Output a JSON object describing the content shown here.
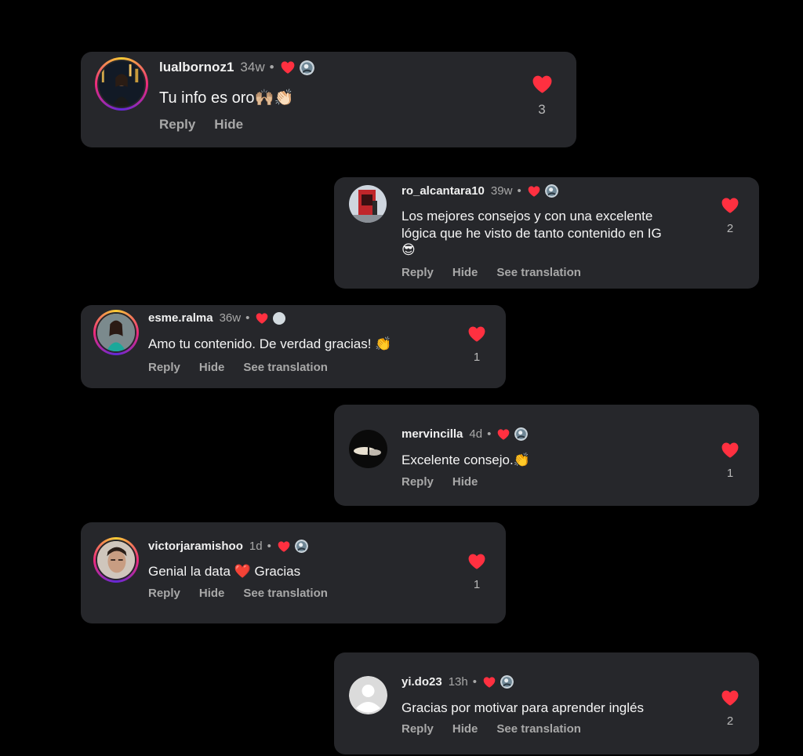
{
  "colors": {
    "background": "#000000",
    "card": "#26272b",
    "heart": "#ff3040",
    "muted": "#a8a8a8"
  },
  "comments": [
    {
      "username": "lualbornoz1",
      "time": "34w",
      "separator": "•",
      "text": "Tu info es oro🙌🏼👏🏻",
      "text_line2": "",
      "actions": [
        "Reply",
        "Hide"
      ],
      "likes": "3"
    },
    {
      "username": "ro_alcantara10",
      "time": "39w",
      "separator": "•",
      "text": "Los mejores consejos y con una excelente",
      "text_line2": "lógica que he visto de tanto contenido en IG",
      "text_line3": "😎",
      "actions": [
        "Reply",
        "Hide",
        "See translation"
      ],
      "likes": "2"
    },
    {
      "username": "esme.ralma",
      "time": "36w",
      "separator": "•",
      "text": "Amo tu contenido. De verdad gracias! 👏",
      "text_line2": "",
      "actions": [
        "Reply",
        "Hide",
        "See translation"
      ],
      "likes": "1"
    },
    {
      "username": "mervincilla",
      "time": "4d",
      "separator": "•",
      "text": "Excelente consejo.👏",
      "text_line2": "",
      "actions": [
        "Reply",
        "Hide"
      ],
      "likes": "1"
    },
    {
      "username": "victorjaramishoo",
      "time": "1d",
      "separator": "•",
      "text": "Genial la data ❤️ Gracias",
      "text_line2": "",
      "actions": [
        "Reply",
        "Hide",
        "See translation"
      ],
      "likes": "1"
    },
    {
      "username": "yi.do23",
      "time": "13h",
      "separator": "•",
      "text": "Gracias por motivar para aprender inglés",
      "text_line2": "",
      "actions": [
        "Reply",
        "Hide",
        "See translation"
      ],
      "likes": "2"
    }
  ]
}
